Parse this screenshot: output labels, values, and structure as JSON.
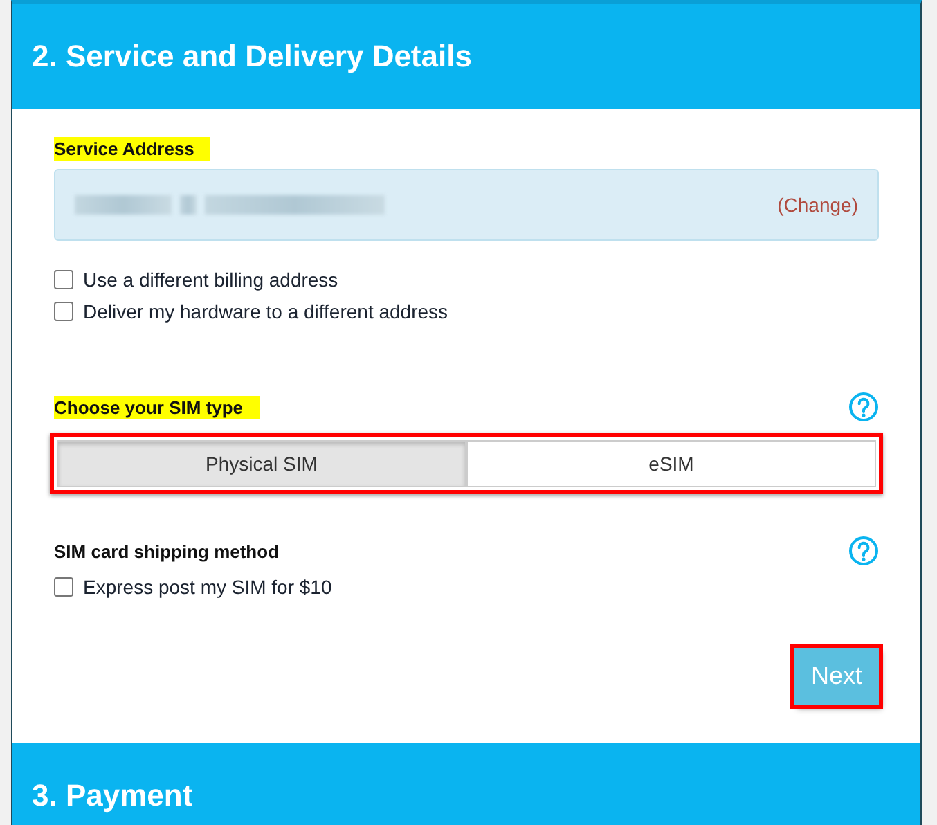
{
  "sections": [
    {
      "title": "2. Service and Delivery Details"
    },
    {
      "title": "3. Payment"
    }
  ],
  "service_address": {
    "label": "Service Address",
    "highlighted": true,
    "change_link": "(Change)"
  },
  "address_options": [
    {
      "label": "Use a different billing address",
      "checked": false
    },
    {
      "label": "Deliver my hardware to a different address",
      "checked": false
    }
  ],
  "sim_type": {
    "label": "Choose your SIM type",
    "highlighted": true,
    "outlined": true,
    "options": [
      {
        "label": "Physical SIM",
        "selected": true
      },
      {
        "label": "eSIM",
        "selected": false
      }
    ]
  },
  "shipping": {
    "label": "SIM card shipping method",
    "options": [
      {
        "label": "Express post my SIM for $10",
        "checked": false
      }
    ]
  },
  "next_button": {
    "label": "Next",
    "outlined": true
  }
}
